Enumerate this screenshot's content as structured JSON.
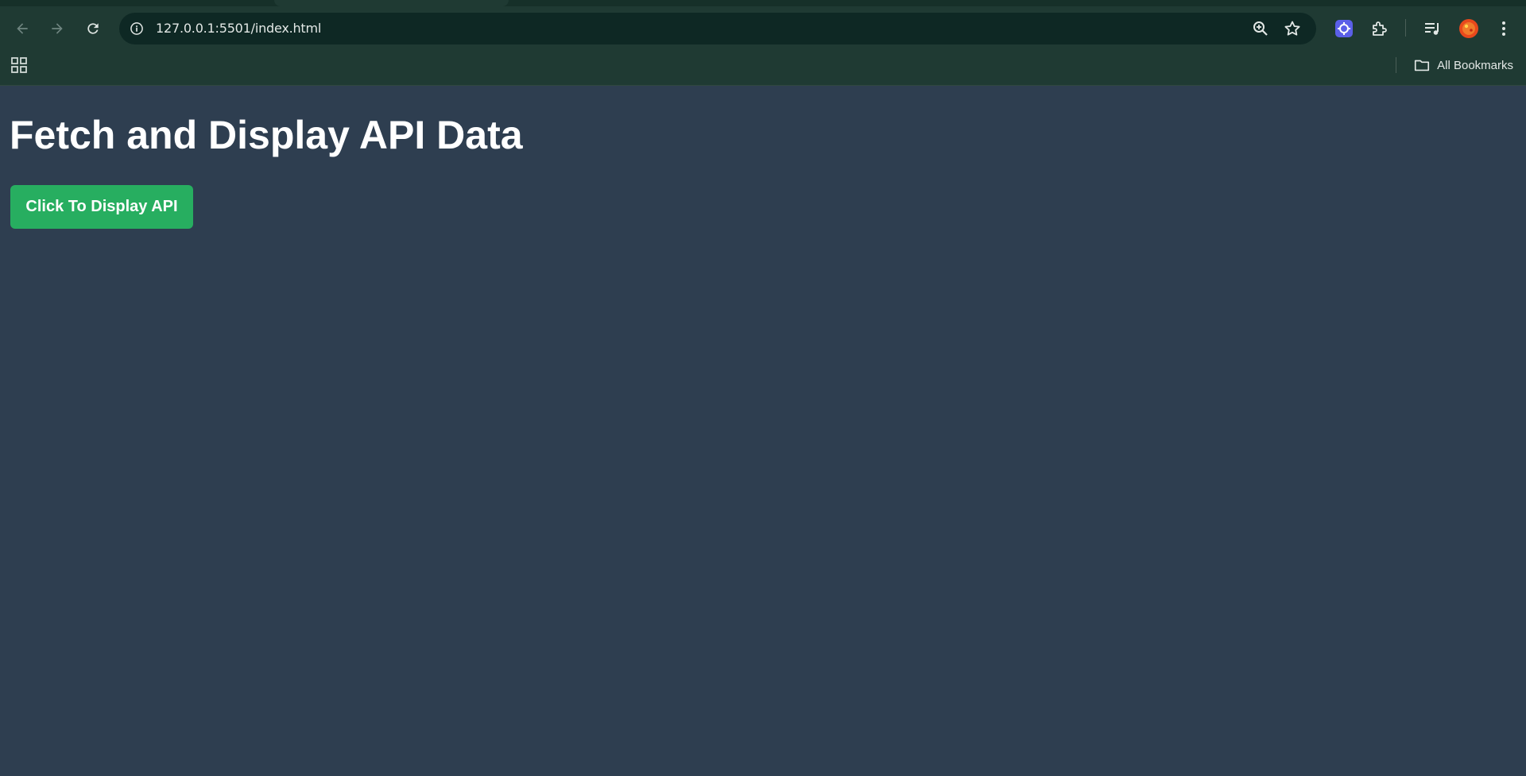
{
  "browser": {
    "url": "127.0.0.1:5501/index.html",
    "bookmarks_label": "All Bookmarks",
    "icons": {
      "back": "arrow-left-icon",
      "forward": "arrow-right-icon",
      "reload": "reload-icon",
      "site_info": "info-icon",
      "zoom": "zoom-in-icon",
      "bookmark_star": "star-icon",
      "extension_1": "extension-badge-icon",
      "extensions": "puzzle-icon",
      "media": "media-queue-icon",
      "profile": "avatar-icon",
      "menu": "more-vertical-icon",
      "apps": "apps-grid-icon",
      "folder": "folder-icon"
    }
  },
  "page": {
    "title": "Fetch and Display API Data",
    "button_label": "Click To Display API",
    "colors": {
      "background": "#2e3e50",
      "button": "#27ae60",
      "text": "#ffffff"
    }
  }
}
